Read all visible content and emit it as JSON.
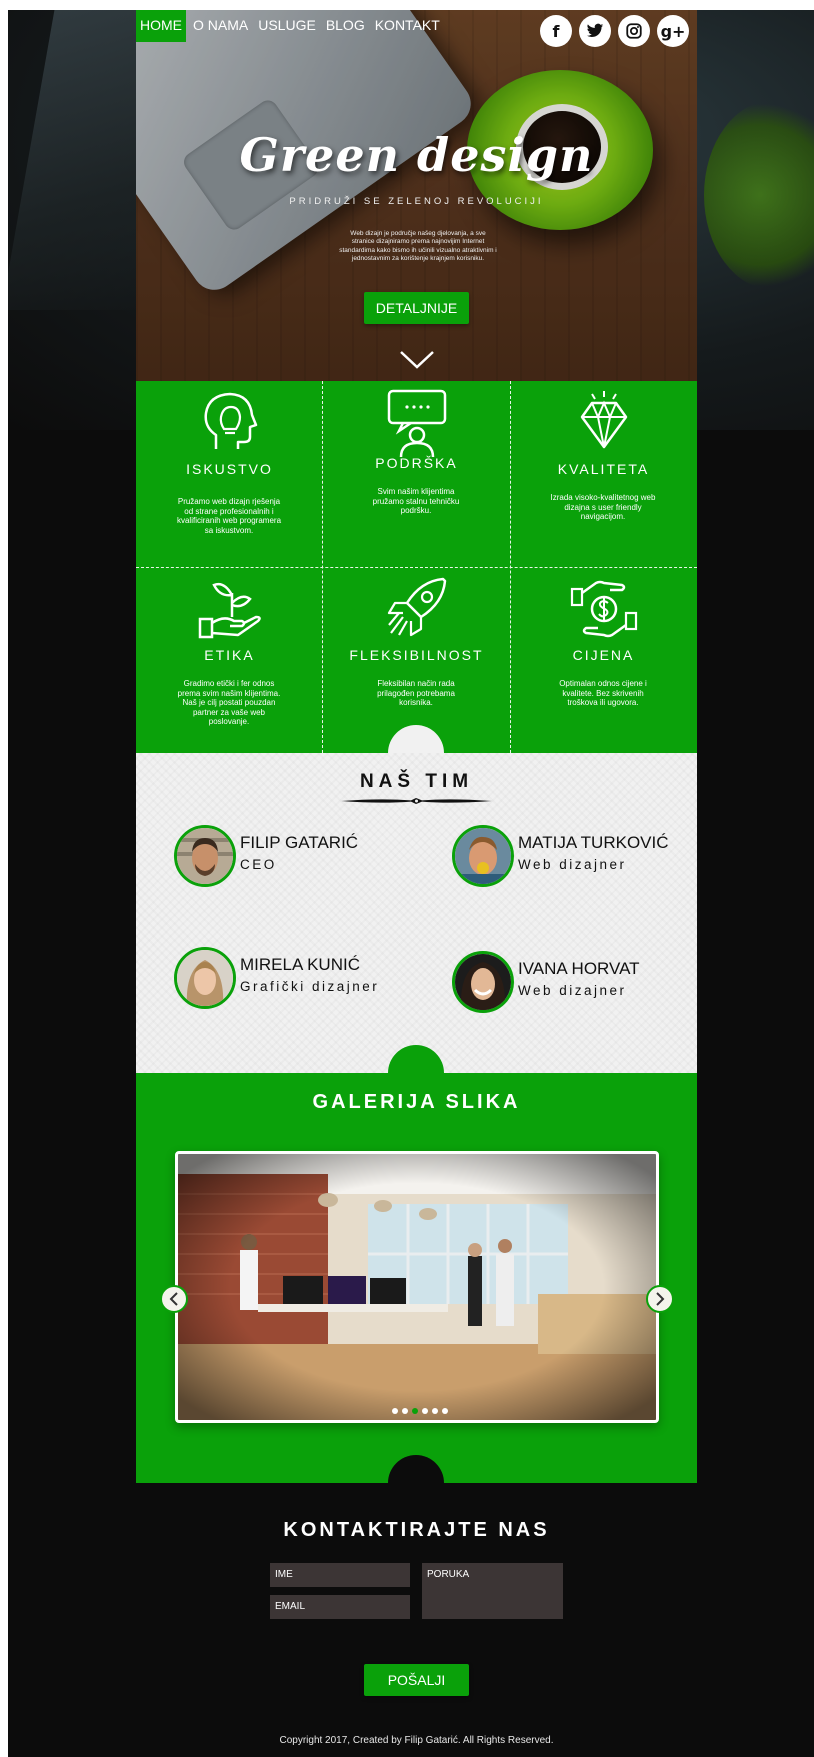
{
  "nav": {
    "items": [
      {
        "label": "HOME",
        "active": true
      },
      {
        "label": "O NAMA",
        "active": false
      },
      {
        "label": "USLUGE",
        "active": false
      },
      {
        "label": "BLOG",
        "active": false
      },
      {
        "label": "KONTAKT",
        "active": false
      }
    ]
  },
  "social": [
    {
      "glyph": "f",
      "icon": "facebook-icon"
    },
    {
      "glyph": "t",
      "icon": "twitter-icon"
    },
    {
      "glyph": "◎",
      "icon": "instagram-icon"
    },
    {
      "glyph": "g+",
      "icon": "google-plus-icon"
    }
  ],
  "hero": {
    "title": "Green design",
    "subtitle": "PRIDRUŽI SE ZELENOJ REVOLUCIJI",
    "text": "Web dizajn je područje našeg djelovanja, a sve stranice dizajniramo prema najnovijim Internet standardima kako bismo ih učinili vizualno atraktivnim i jednostavnim za korištenje krajnjem korisniku.",
    "button": "DETALJNIJE"
  },
  "features": [
    {
      "title": "ISKUSTVO",
      "text": "Pružamo web dizajn rješenja od strane profesionalnih i kvalificiranih web programera sa iskustvom.",
      "icon": "lightbulb-head-icon"
    },
    {
      "title": "PODRŠKA",
      "text": "Svim našim klijentima pružamo stalnu tehničku podršku.",
      "icon": "support-chat-icon"
    },
    {
      "title": "KVALITETA",
      "text": "Izrada visoko-kvalitetnog web dizajna s user friendly navigacijom.",
      "icon": "diamond-icon"
    },
    {
      "title": "ETIKA",
      "text": "Gradimo etički i fer odnos prema svim našim klijentima. Naš je cilj postati pouzdan partner za vaše web poslovanje.",
      "icon": "plant-hand-icon"
    },
    {
      "title": "FLEKSIBILNOST",
      "text": "Fleksibilan način rada prilagođen potrebama korisnika.",
      "icon": "rocket-icon"
    },
    {
      "title": "CIJENA",
      "text": "Optimalan odnos cijene i kvalitete. Bez skrivenih troškova ili ugovora.",
      "icon": "money-hands-icon"
    }
  ],
  "team": {
    "title": "NAŠ TIM",
    "members": [
      {
        "name": "FILIP GATARIĆ",
        "role": "CEO"
      },
      {
        "name": "MATIJA TURKOVIĆ",
        "role": "Web dizajner"
      },
      {
        "name": "MIRELA KUNIĆ",
        "role": "Grafički dizajner"
      },
      {
        "name": "IVANA HORVAT",
        "role": "Web dizajner"
      }
    ]
  },
  "gallery": {
    "title": "GALERIJA SLIKA",
    "slide_count": 6,
    "active_slide": 3
  },
  "contact": {
    "title": "KONTAKTIRAJTE NAS",
    "name_placeholder": "IME",
    "email_placeholder": "EMAIL",
    "message_placeholder": "PORUKA",
    "button": "POŠALJI"
  },
  "footer": {
    "copyright": "Copyright 2017, Created by Filip Gatarić. All Rights Reserved."
  },
  "colors": {
    "brand_green": "#0aa10a",
    "page_dark": "#0c0c0c",
    "team_bg": "#f1f1f1",
    "input_bg": "#3c3535"
  }
}
